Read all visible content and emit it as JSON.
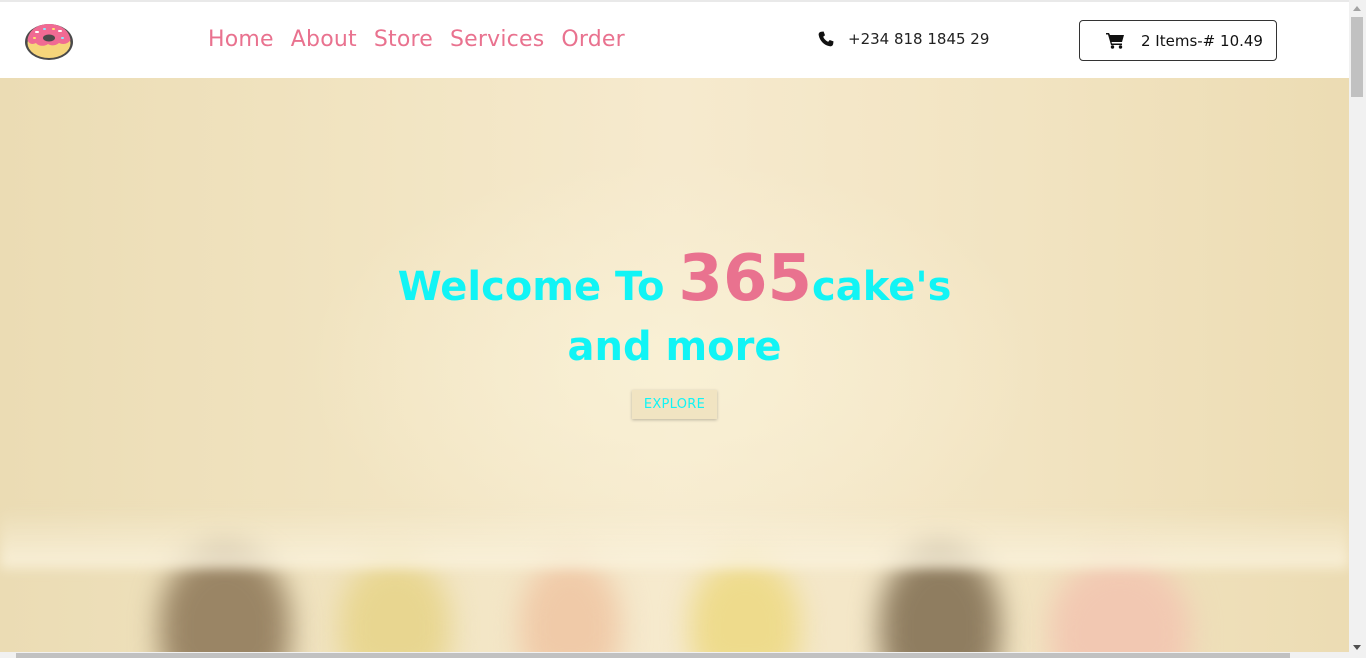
{
  "nav": {
    "logo_icon": "donut-icon",
    "links": [
      {
        "label": "Home"
      },
      {
        "label": "About"
      },
      {
        "label": "Store"
      },
      {
        "label": "Services"
      },
      {
        "label": "Order"
      }
    ],
    "phone_icon": "phone-icon",
    "phone": "+234 818 1845 29",
    "cart_icon": "shopping-cart-icon",
    "cart_label": "2 Items-# 10.49"
  },
  "hero": {
    "welcome": "Welcome To ",
    "accent": "365",
    "suffix": "cake's",
    "line2": "and more",
    "button": "EXPLORE"
  },
  "colors": {
    "accent_pink": "#e9728f",
    "hero_text_cyan": "#11f4f5",
    "hero_bg": "#f2e5c3"
  }
}
